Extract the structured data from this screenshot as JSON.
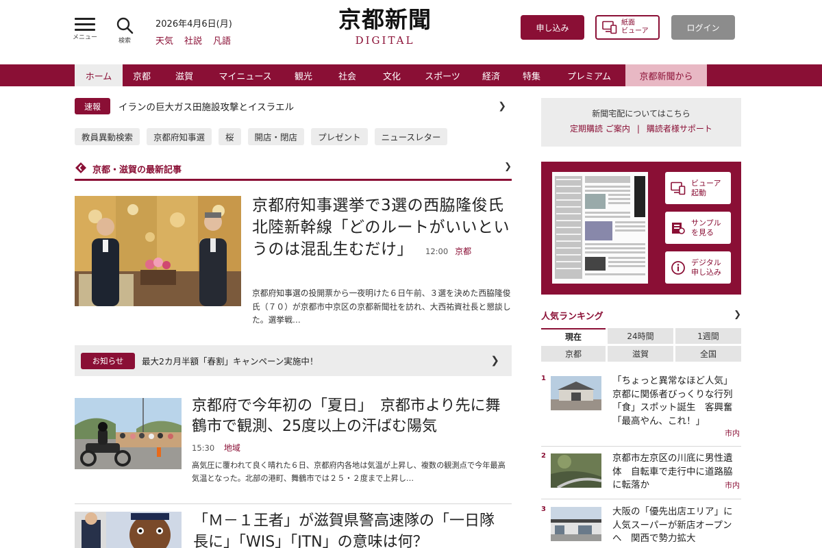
{
  "header": {
    "menu_label": "メニュー",
    "search_label": "検索",
    "date": "2026年4月6日(月)",
    "links": [
      "天気",
      "社説",
      "凡語"
    ],
    "logo_main": "京都新聞",
    "logo_sub": "DIGITAL",
    "apply_label": "申し込み",
    "viewer_label_1": "紙面",
    "viewer_label_2": "ビューア",
    "login_label": "ログイン"
  },
  "nav": {
    "items": [
      "ホーム",
      "京都",
      "滋賀",
      "マイニュース",
      "観光",
      "社会",
      "文化",
      "スポーツ",
      "経済",
      "特集",
      "プレミアム",
      "京都新聞から"
    ]
  },
  "breaking": {
    "tag": "速報",
    "text": "イランの巨大ガス田施設攻撃とイスラエル"
  },
  "tags": [
    "教員異動検索",
    "京都府知事選",
    "桜",
    "開店・閉店",
    "プレゼント",
    "ニュースレター"
  ],
  "section": {
    "title": "京都・滋賀の最新記事"
  },
  "lead": {
    "title": "京都府知事選挙で3選の西脇隆俊氏　北陸新幹線「どのルートがいいというのは混乱生むだけ」",
    "time": "12:00",
    "category": "京都",
    "summary": "京都府知事選の投開票から一夜明けた６日午前、３選を決めた西脇隆俊氏（７０）が京都市中京区の京都新聞社を訪れ、大西祐資社長と懇談した。選挙戦…"
  },
  "notice": {
    "tag": "お知らせ",
    "text": "最大2カ月半額「春割」キャンペーン実施中！"
  },
  "story2": {
    "title": "京都府で今年初の「夏日」　京都市より先に舞鶴市で観測、25度以上の汗ばむ陽気",
    "time": "15:30",
    "category": "地域",
    "summary": "高気圧に覆われて良く晴れた６日、京都府内各地は気温が上昇し、複数の観測点で今年最高気温となった。北部の港町、舞鶴市では２５・２度まで上昇し…"
  },
  "story3": {
    "title": "「Ｍ－１王者」が滋賀県警高速隊の「一日隊長に」「WIS」「JTN」の意味は何？"
  },
  "sidebar": {
    "delivery_line1": "新聞宅配についてはこちら",
    "delivery_link1": "定期購読 ご案内",
    "delivery_sep": "|",
    "delivery_link2": "購読者様サポート",
    "paper_buttons": [
      {
        "line1": "ビューア",
        "line2": "起動"
      },
      {
        "line1": "サンプル",
        "line2": "を見る"
      },
      {
        "line1": "デジタル",
        "line2": "申し込み"
      }
    ],
    "ranking_title": "人気ランキング",
    "ranking_tabs": [
      "現在",
      "24時間",
      "1週間",
      "京都",
      "滋賀",
      "全国"
    ],
    "ranking": [
      {
        "num": "1",
        "title": "「ちょっと異常なほど人気」京都に関係者びっくりな行列「食」スポット誕生　客興奮「最高やん、これ！」",
        "category": "市内"
      },
      {
        "num": "2",
        "title": "京都市左京区の川底に男性遺体　自転車で走行中に道路脇に転落か",
        "category": "市内"
      },
      {
        "num": "3",
        "title": "大阪の「優先出店エリア」に人気スーパーが新店オープンへ　関西で勢力拡大",
        "category": ""
      }
    ]
  },
  "colors": {
    "brand": "#8a0f35",
    "nav_active_bg": "#ececec",
    "nav_tail_bg": "#e8b8c4",
    "chip_bg": "#ececec",
    "login_bg": "#8c8c8c"
  }
}
